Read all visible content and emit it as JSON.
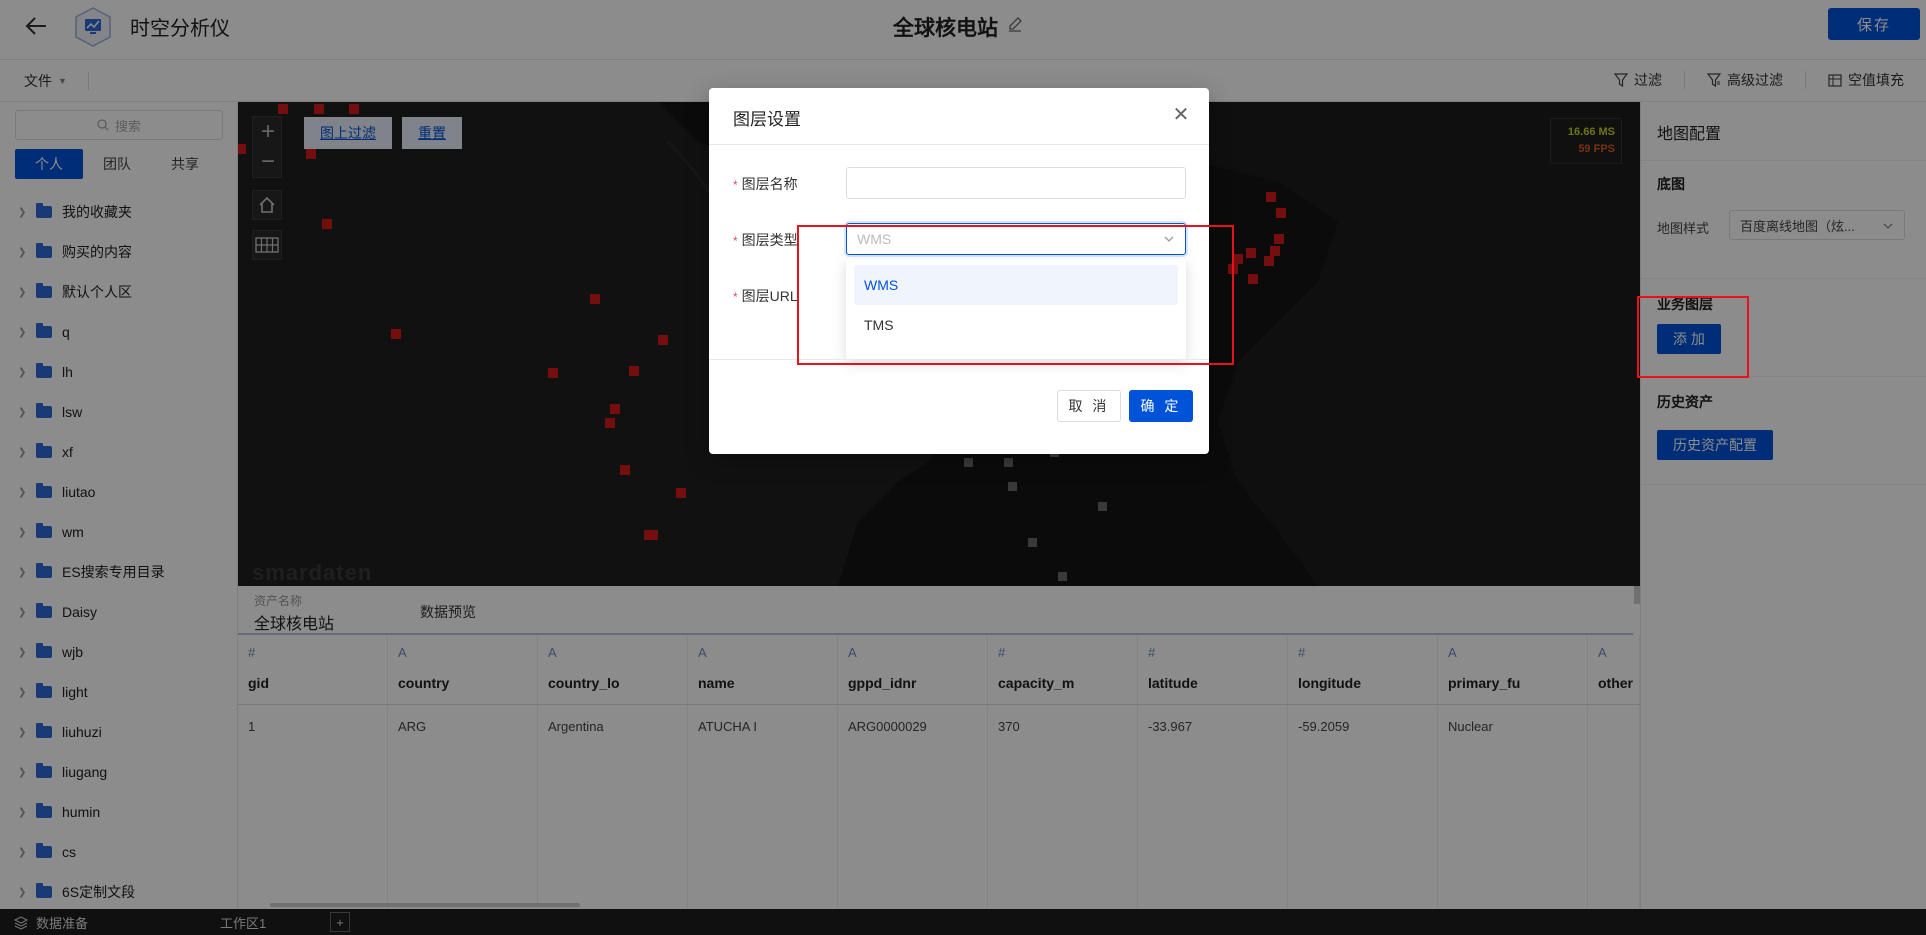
{
  "header": {
    "app_name": "时空分析仪",
    "doc_title": "全球核电站",
    "save_label": "保存"
  },
  "toolbar": {
    "file_menu": "文件",
    "filter": "过滤",
    "advanced_filter": "高级过滤",
    "null_fill": "空值填充"
  },
  "sidebar": {
    "search_placeholder": "搜索",
    "tabs": [
      "个人",
      "团队",
      "共享"
    ],
    "items": [
      "我的收藏夹",
      "购买的内容",
      "默认个人区",
      "q",
      "lh",
      "lsw",
      "xf",
      "liutao",
      "wm",
      "ES搜索专用目录",
      "Daisy",
      "wjb",
      "light",
      "liuhuzi",
      "liugang",
      "humin",
      "cs",
      "6S定制文段"
    ]
  },
  "map": {
    "filter_on_map": "图上过滤",
    "reset": "重置",
    "fps_ms": "16.66 MS",
    "fps_fps": "59 FPS",
    "watermark": "smardaten"
  },
  "right_panel": {
    "title": "地图配置",
    "basemap_section": "底图",
    "map_style_label": "地图样式",
    "map_style_value": "百度离线地图（炫...",
    "business_layers": "业务图层",
    "add_button": "添 加",
    "history_assets": "历史资产",
    "history_config_button": "历史资产配置"
  },
  "data_panel": {
    "asset_name_label": "资产名称",
    "asset_name": "全球核电站",
    "preview_tab": "数据预览",
    "columns": [
      {
        "type": "#",
        "name": "gid",
        "value": "1"
      },
      {
        "type": "A",
        "name": "country",
        "value": "ARG"
      },
      {
        "type": "A",
        "name": "country_lo",
        "value": "Argentina"
      },
      {
        "type": "A",
        "name": "name",
        "value": "ATUCHA I"
      },
      {
        "type": "A",
        "name": "gppd_idnr",
        "value": "ARG0000029"
      },
      {
        "type": "#",
        "name": "capacity_m",
        "value": "370"
      },
      {
        "type": "#",
        "name": "latitude",
        "value": "-33.967"
      },
      {
        "type": "#",
        "name": "longitude",
        "value": "-59.2059"
      },
      {
        "type": "A",
        "name": "primary_fu",
        "value": "Nuclear"
      },
      {
        "type": "A",
        "name": "other",
        "value": ""
      }
    ]
  },
  "bottom_bar": {
    "data_prep": "数据准备",
    "workspace": "工作区1"
  },
  "modal": {
    "title": "图层设置",
    "layer_name_label": "图层名称",
    "layer_type_label": "图层类型",
    "layer_url_label": "图层URL",
    "layer_type_placeholder": "WMS",
    "options": [
      "WMS",
      "TMS"
    ],
    "cancel": "取 消",
    "ok": "确 定"
  },
  "colors": {
    "primary": "#0052d9",
    "annotation": "#e8121b",
    "map_bg": "#141414",
    "marker": "#d51b1b"
  }
}
